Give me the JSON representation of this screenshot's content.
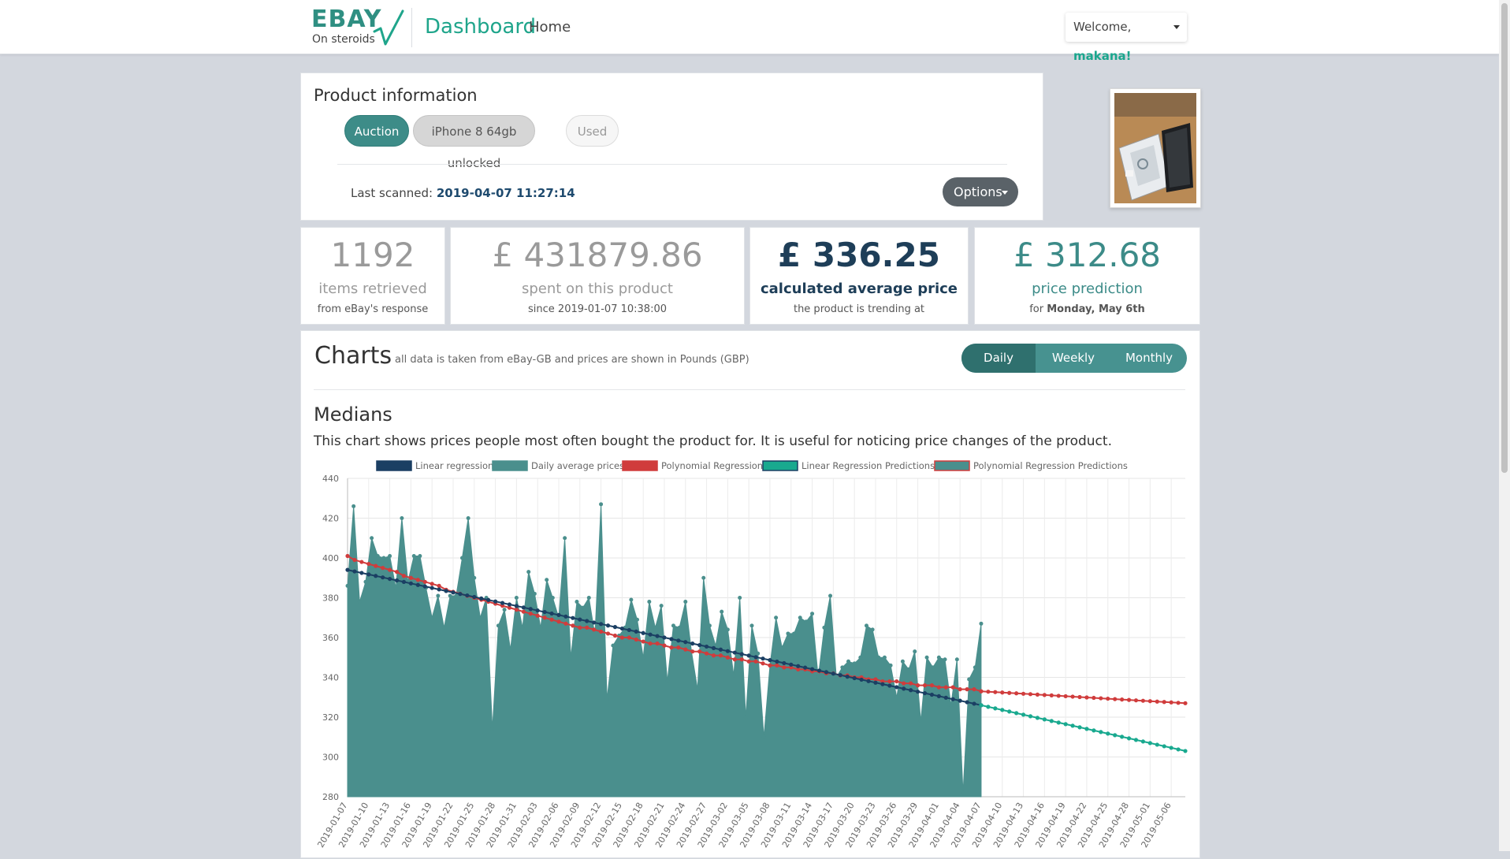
{
  "header": {
    "logo_title": "EBAY",
    "logo_subtitle": "On steroids",
    "dashboard_label": "Dashboard",
    "home_label": "Home",
    "welcome_prefix": "Welcome,",
    "username": "makana!"
  },
  "product": {
    "section_title": "Product information",
    "tags": {
      "type": "Auction",
      "name": "iPhone 8 64gb unlocked",
      "condition": "Used"
    },
    "last_scanned_label": "Last scanned:",
    "last_scanned_value": "2019-04-07 11:27:14",
    "options_label": "Options"
  },
  "stats": {
    "items": {
      "value": "1192",
      "label": "items retrieved",
      "sub": "from eBay's response"
    },
    "spent": {
      "value": "£ 431879.86",
      "label": "spent on this product",
      "sub_prefix": "since",
      "sub_value": "2019-01-07 10:38:00"
    },
    "average": {
      "value": "£ 336.25",
      "label": "calculated average price",
      "sub": "the product is trending at"
    },
    "prediction": {
      "value": "£ 312.68",
      "label": "price prediction",
      "sub_prefix": "for",
      "sub_value": "Monday, May 6th"
    }
  },
  "charts": {
    "title": "Charts",
    "note": "all data is taken from eBay-GB and prices are shown in Pounds (GBP)",
    "periods": [
      "Daily",
      "Weekly",
      "Monthly"
    ],
    "active_period": "Daily",
    "medians_title": "Medians",
    "medians_desc": "This chart shows prices people most often bought the product for. It is useful for noticing price changes of the product."
  },
  "chart_data": {
    "type": "line",
    "x_tick_labels": [
      "2019-01-07",
      "2019-01-10",
      "2019-01-13",
      "2019-01-16",
      "2019-01-19",
      "2019-01-22",
      "2019-01-25",
      "2019-01-28",
      "2019-01-31",
      "2019-02-03",
      "2019-02-06",
      "2019-02-09",
      "2019-02-12",
      "2019-02-15",
      "2019-02-18",
      "2019-02-21",
      "2019-02-24",
      "2019-02-27",
      "2019-03-02",
      "2019-03-05",
      "2019-03-08",
      "2019-03-11",
      "2019-03-14",
      "2019-03-17",
      "2019-03-20",
      "2019-03-23",
      "2019-03-26",
      "2019-03-29",
      "2019-04-01",
      "2019-04-04",
      "2019-04-07",
      "2019-04-10",
      "2019-04-13",
      "2019-04-16",
      "2019-04-19",
      "2019-04-22",
      "2019-04-25",
      "2019-04-28",
      "2019-05-01",
      "2019-05-06"
    ],
    "ylim": [
      280,
      440
    ],
    "y_ticks": [
      280,
      300,
      320,
      340,
      360,
      380,
      400,
      420,
      440
    ],
    "n_days": 120,
    "observed_days": 91,
    "grid": true,
    "legend_position": "top",
    "series": [
      {
        "name": "Linear regression",
        "color": "#1b3f63",
        "start": 394,
        "end": 326,
        "day_start": 0,
        "day_end": 90
      },
      {
        "name": "Daily average prices",
        "color": "#4a8f8d",
        "values": [
          386,
          426,
          378,
          388,
          410,
          401,
          400,
          401,
          385,
          420,
          388,
          401,
          401,
          385,
          370,
          381,
          365,
          381,
          381,
          400,
          420,
          390,
          370,
          380,
          314,
          366,
          374,
          354,
          380,
          365,
          393,
          382,
          365,
          389,
          380,
          370,
          410,
          350,
          378,
          375,
          380,
          361,
          427,
          329,
          356,
          361,
          365,
          379,
          369,
          350,
          378,
          365,
          376,
          338,
          366,
          365,
          378,
          353,
          334,
          390,
          366,
          356,
          373,
          364,
          341,
          380,
          320,
          366,
          352,
          310,
          346,
          370,
          355,
          362,
          362,
          370,
          368,
          372,
          340,
          365,
          381,
          340,
          345,
          348,
          347,
          350,
          366,
          364,
          350,
          350,
          346,
          330,
          348,
          344,
          353,
          318,
          350,
          345,
          350,
          349,
          326,
          349,
          282,
          339,
          345,
          367
        ]
      },
      {
        "name": "Polynomial Regression",
        "color": "#d03c3c",
        "values": [
          401,
          399,
          398,
          397,
          396,
          395,
          394,
          393,
          391,
          390,
          389,
          388,
          387,
          386,
          384,
          383,
          382,
          381,
          380,
          379,
          378,
          377,
          376,
          375,
          374,
          373,
          372,
          371,
          370,
          369,
          368,
          367,
          366,
          365,
          365,
          364,
          363,
          362,
          361,
          360,
          360,
          359,
          358,
          357,
          357,
          356,
          355,
          355,
          354,
          353,
          353,
          352,
          351,
          351,
          350,
          349,
          349,
          348,
          348,
          347,
          346,
          346,
          345,
          345,
          344,
          344,
          343,
          343,
          342,
          342,
          341,
          341,
          340,
          340,
          339,
          339,
          338,
          338,
          338,
          337,
          337,
          336,
          336,
          336,
          335,
          335,
          335,
          334,
          334,
          334,
          333
        ]
      },
      {
        "name": "Linear Regression Predictions",
        "color": "#19a98f",
        "start": 326,
        "end": 303,
        "day_start": 90,
        "day_end": 119
      },
      {
        "name": "Polynomial Regression Predictions",
        "color": "#d03c3c",
        "start": 333,
        "end": 327,
        "day_start": 90,
        "day_end": 119
      }
    ]
  }
}
